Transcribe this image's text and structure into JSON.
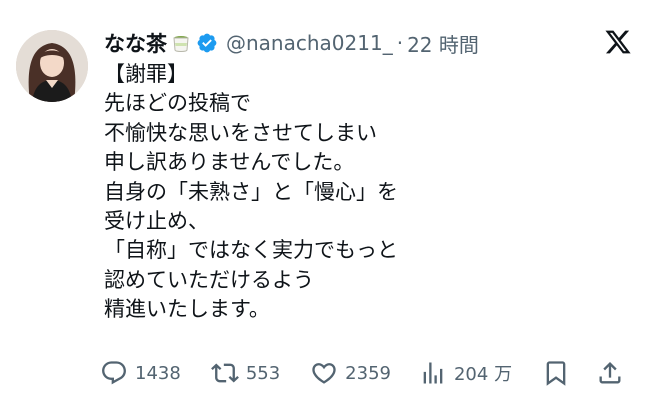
{
  "author": {
    "display_name": "なな茶",
    "emoji_icon": "green-tea-icon",
    "verified_icon": "verified-badge-icon",
    "handle": "@nanacha0211_",
    "separator": "·",
    "time": "22 時間"
  },
  "header_icon": "x-logo-icon",
  "post": {
    "lines": [
      "【謝罪】",
      "先ほどの投稿で",
      "不愉快な思いをさせてしまい",
      "申し訳ありませんでした。",
      "自身の「未熟さ」と「慢心」を",
      "受け止め、",
      "「自称」ではなく実力でもっと",
      "認めていただけるよう",
      "精進いたします。"
    ]
  },
  "actions": {
    "reply_count": "1438",
    "repost_count": "553",
    "like_count": "2359",
    "views_count": "204 万"
  },
  "colors": {
    "text": "#0f1419",
    "secondary": "#536471",
    "verified": "#1d9bf0"
  }
}
